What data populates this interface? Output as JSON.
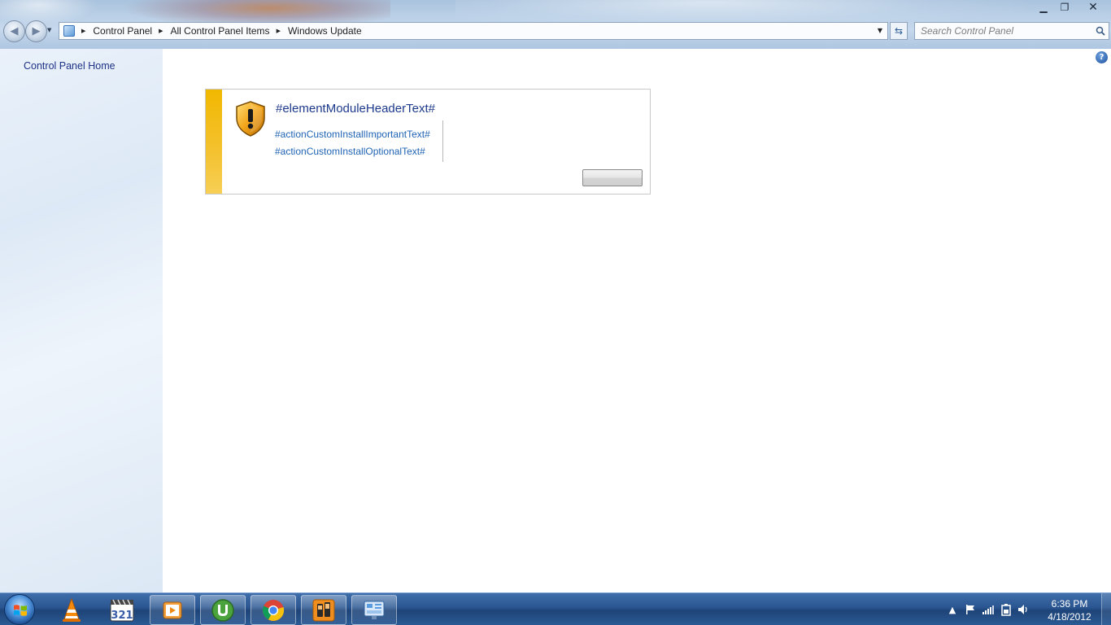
{
  "window": {
    "controls": {
      "minimize": "▁",
      "maximize": "❐",
      "close": "✕"
    }
  },
  "address_bar": {
    "crumbs": [
      "Control Panel",
      "All Control Panel Items",
      "Windows Update"
    ]
  },
  "search": {
    "placeholder": "Search Control Panel"
  },
  "left_pane": {
    "home_link": "Control Panel Home"
  },
  "module": {
    "header": "#elementModuleHeaderText#",
    "important_link": "#actionCustomInstallImportantText#",
    "optional_link": "#actionCustomInstallOptionalText#",
    "stripe_color": "#f1b800",
    "action_button_label": ""
  },
  "help": {
    "glyph": "?"
  },
  "taskbar": {
    "pinned": [
      "vlc-icon",
      "media-player-classic-icon",
      "video-player-icon",
      "utorrent-icon",
      "chrome-icon",
      "phone-app-icon",
      "control-panel-icon"
    ],
    "clock": {
      "time": "6:36 PM",
      "date": "4/18/2012"
    }
  },
  "colors": {
    "link": "#2064b5",
    "header_text": "#1e3a8c",
    "left_pane_bg": "#e5eef8"
  }
}
